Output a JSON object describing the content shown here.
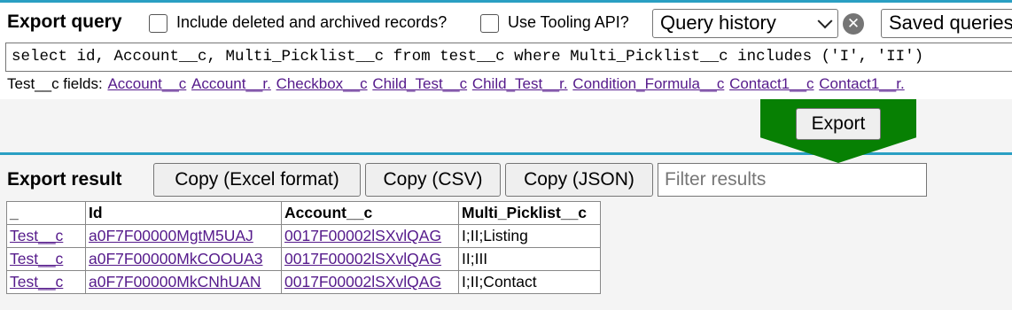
{
  "query_panel": {
    "title": "Export query",
    "include_deleted_label": "Include deleted and archived records?",
    "tooling_api_label": "Use Tooling API?",
    "history_select": "Query history",
    "clear_icon": "x-circle-icon",
    "saved_select": "Saved queries",
    "query_text": "select id, Account__c, Multi_Picklist__c from test__c where Multi_Picklist__c includes ('I', 'II')",
    "fields_label": "Test__c fields:",
    "fields": [
      "Account__c",
      "Account__r.",
      "Checkbox__c",
      "Child_Test__c",
      "Child_Test__r.",
      "Condition_Formula__c",
      "Contact1__c",
      "Contact1__r."
    ]
  },
  "export_button": "Export",
  "result_panel": {
    "title": "Export result",
    "copy_excel": "Copy (Excel format)",
    "copy_csv": "Copy (CSV)",
    "copy_json": "Copy (JSON)",
    "filter_placeholder": "Filter results",
    "columns": [
      "_",
      "Id",
      "Account__c",
      "Multi_Picklist__c"
    ],
    "rows": [
      [
        "Test__c",
        "a0F7F00000MgtM5UAJ",
        "0017F00002lSXvlQAG",
        "I;II;Listing"
      ],
      [
        "Test__c",
        "a0F7F00000MkCOOUA3",
        "0017F00002lSXvlQAG",
        "II;III"
      ],
      [
        "Test__c",
        "a0F7F00000MkCNhUAN",
        "0017F00002lSXvlQAG",
        "I;II;Contact"
      ]
    ]
  },
  "colors": {
    "accent": "#2a9fc3",
    "export_arrow": "#078003",
    "link": "#551a8b"
  }
}
